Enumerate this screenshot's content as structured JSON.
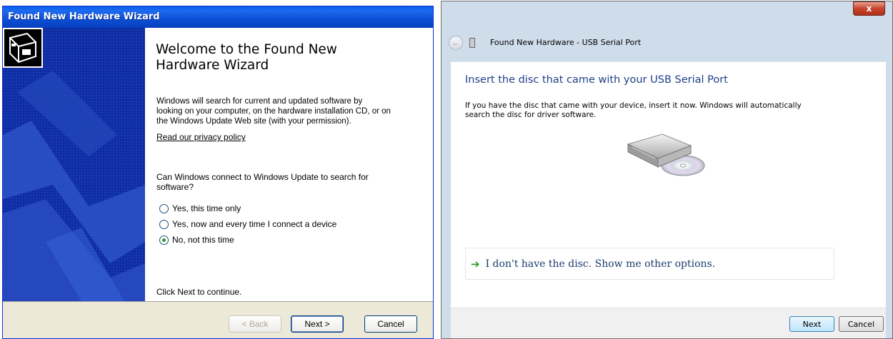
{
  "xp_wizard": {
    "title": "Found New Hardware Wizard",
    "heading_line1": "Welcome to the Found New",
    "heading_line2": "Hardware Wizard",
    "intro_line1": "Windows will search for current and updated software by",
    "intro_line2": "looking on your computer, on the hardware installation CD, or on",
    "intro_line3": "the Windows Update Web site (with your permission).",
    "privacy_link": "Read our privacy policy",
    "question_line1": "Can Windows connect to Windows Update to search for",
    "question_line2": "software?",
    "options": [
      {
        "label": "Yes, this time only",
        "selected": false
      },
      {
        "label": "Yes, now and every time I connect a device",
        "selected": false
      },
      {
        "label": "No, not this time",
        "selected": true
      }
    ],
    "continue_text": "Click Next to continue.",
    "buttons": {
      "back": "< Back",
      "next": "Next >",
      "cancel": "Cancel"
    },
    "icons": {
      "side_panel": "hardware-card-icon"
    }
  },
  "vista_wizard": {
    "title": "Found New Hardware - USB Serial Port",
    "close_glyph": "x",
    "instruction": "Insert the disc that came with your USB Serial Port",
    "body_line1": "If you have the disc that came with your device, insert it now.  Windows will automatically",
    "body_line2": "search the disc for driver software.",
    "command_link": "I don't have the disc.  Show me other options.",
    "arrow_glyph": "➔",
    "back_glyph": "←",
    "buttons": {
      "next": "Next",
      "cancel": "Cancel"
    },
    "icons": {
      "back": "back-arrow-icon",
      "device": "usb-device-icon",
      "disc": "disc-drive-icon",
      "command": "green-arrow-icon"
    }
  }
}
